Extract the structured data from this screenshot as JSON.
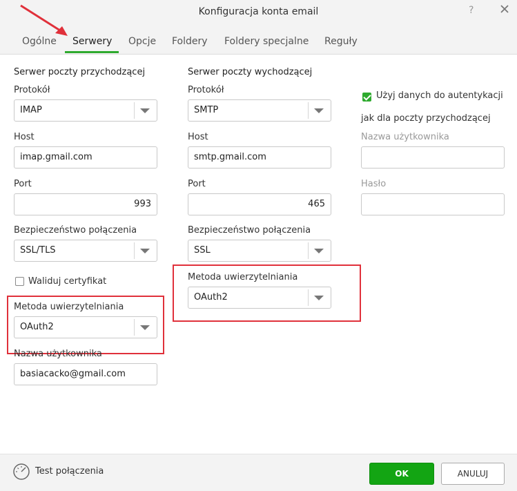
{
  "window": {
    "title": "Konfiguracja konta email",
    "help": "?"
  },
  "tabs": [
    "Ogólne",
    "Serwery",
    "Opcje",
    "Foldery",
    "Foldery specjalne",
    "Reguły"
  ],
  "active_tab": "Serwery",
  "incoming": {
    "heading": "Serwer poczty przychodzącej",
    "protocol_label": "Protokół",
    "protocol_value": "IMAP",
    "host_label": "Host",
    "host_value": "imap.gmail.com",
    "port_label": "Port",
    "port_value": "993",
    "security_label": "Bezpieczeństwo połączenia",
    "security_value": "SSL/TLS",
    "validate_cert_label": "Waliduj certyfikat",
    "validate_cert_checked": false,
    "auth_label": "Metoda uwierzytelniania",
    "auth_value": "OAuth2",
    "username_label": "Nazwa użytkownika",
    "username_value": "basiacacko@gmail.com"
  },
  "outgoing": {
    "heading": "Serwer poczty wychodzącej",
    "protocol_label": "Protokół",
    "protocol_value": "SMTP",
    "host_label": "Host",
    "host_value": "smtp.gmail.com",
    "port_label": "Port",
    "port_value": "465",
    "security_label": "Bezpieczeństwo połączenia",
    "security_value": "SSL",
    "auth_label": "Metoda uwierzytelniania",
    "auth_value": "OAuth2"
  },
  "auth_panel": {
    "use_credentials_label": "Użyj danych do autentykacji",
    "use_credentials_label_2": "jak dla poczty przychodzącej",
    "use_credentials_checked": true,
    "username_label": "Nazwa użytkownika",
    "username_value": "",
    "password_label": "Hasło",
    "password_value": ""
  },
  "footer": {
    "test_connection": "Test połączenia",
    "ok": "OK",
    "cancel": "ANULUJ"
  },
  "colors": {
    "accent": "#2eaa2e",
    "ok_button": "#13a513",
    "highlight": "#e0303a",
    "arrow": "#e0303a"
  },
  "icons": [
    "close-icon",
    "speedometer-icon",
    "dropdown-caret-icon",
    "annotation-arrow-icon"
  ]
}
